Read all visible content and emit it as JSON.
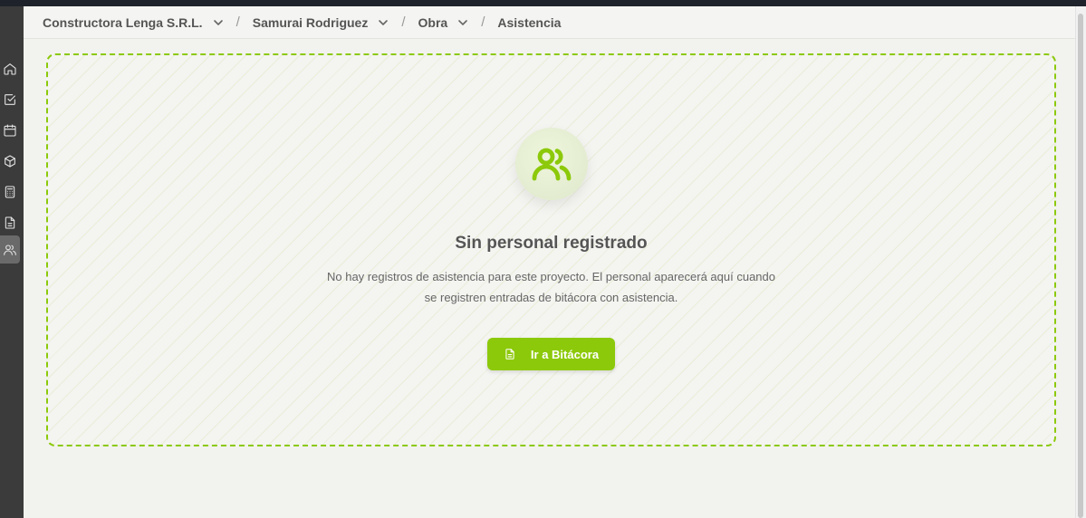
{
  "breadcrumb": {
    "items": [
      {
        "label": "Constructora Lenga S.R.L.",
        "has_dropdown": true
      },
      {
        "label": "Samurai Rodriguez",
        "has_dropdown": true
      },
      {
        "label": "Obra",
        "has_dropdown": true
      },
      {
        "label": "Asistencia",
        "has_dropdown": false
      }
    ],
    "separator": "/"
  },
  "sidebar": {
    "items": [
      {
        "icon": "home-icon",
        "active": false
      },
      {
        "icon": "checkbox-icon",
        "active": false
      },
      {
        "icon": "calendar-icon",
        "active": false
      },
      {
        "icon": "box-icon",
        "active": false
      },
      {
        "icon": "calculator-icon",
        "active": false
      },
      {
        "icon": "document-icon",
        "active": false
      },
      {
        "icon": "users-icon",
        "active": true
      }
    ]
  },
  "empty_state": {
    "icon": "users-icon",
    "title": "Sin personal registrado",
    "description": "No hay registros de asistencia para este proyecto. El personal aparecerá aquí cuando se registren entradas de bitácora con asistencia.",
    "button_label": "Ir a Bitácora",
    "button_icon": "document-icon"
  },
  "colors": {
    "accent": "#8cc90a",
    "sidebar_bg": "#3b3b3b",
    "page_bg": "#f2f2ef"
  }
}
